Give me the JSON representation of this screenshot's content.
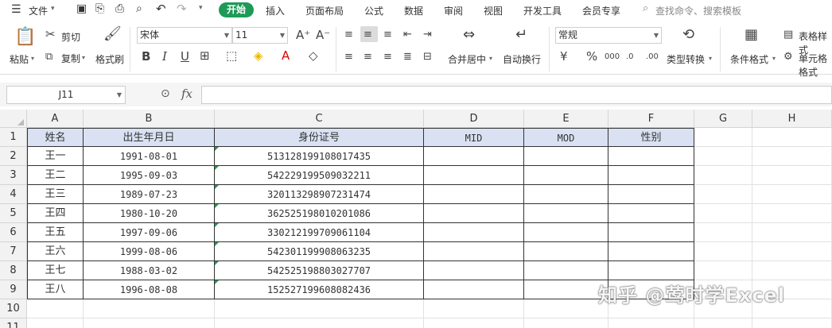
{
  "menubar": {
    "file_label": "文件",
    "tabs": [
      "开始",
      "插入",
      "页面布局",
      "公式",
      "数据",
      "审阅",
      "视图",
      "开发工具",
      "会员专享"
    ],
    "search_placeholder": "查找命令、搜索模板"
  },
  "ribbon": {
    "paste": "粘贴",
    "cut": "剪切",
    "copy": "复制",
    "format_painter": "格式刷",
    "font_name": "宋体",
    "font_size": "11",
    "merge_center": "合并居中",
    "wrap_text": "自动换行",
    "number_format": "常规",
    "type_convert": "类型转换",
    "conditional_format": "条件格式",
    "table_style": "表格样式",
    "cell_format": "单元格格式"
  },
  "formula_bar": {
    "cell_ref": "J11",
    "fx": "fx",
    "value": ""
  },
  "columns": [
    "A",
    "B",
    "C",
    "D",
    "E",
    "F",
    "G",
    "H"
  ],
  "row_numbers": [
    "1",
    "2",
    "3",
    "4",
    "5",
    "6",
    "7",
    "8",
    "9",
    "10",
    "11"
  ],
  "table": {
    "headers": [
      "姓名",
      "出生年月日",
      "身份证号",
      "MID",
      "MOD",
      "性别"
    ],
    "rows": [
      [
        "王一",
        "1991-08-01",
        "513128199108017435",
        "",
        "",
        ""
      ],
      [
        "王二",
        "1995-09-03",
        "542229199509032211",
        "",
        "",
        ""
      ],
      [
        "王三",
        "1989-07-23",
        "320113298907231474",
        "",
        "",
        ""
      ],
      [
        "王四",
        "1980-10-20",
        "362525198010201086",
        "",
        "",
        ""
      ],
      [
        "王五",
        "1997-09-06",
        "330212199709061104",
        "",
        "",
        ""
      ],
      [
        "王六",
        "1999-08-06",
        "542301199908063235",
        "",
        "",
        ""
      ],
      [
        "王七",
        "1988-03-02",
        "542525198803027707",
        "",
        "",
        ""
      ],
      [
        "王八",
        "1996-08-08",
        "152527199608082436",
        "",
        "",
        ""
      ]
    ]
  },
  "watermark": "知乎 @莺时学Excel",
  "colors": {
    "accent": "#1e9a56",
    "header_fill": "#d9e1f2"
  }
}
